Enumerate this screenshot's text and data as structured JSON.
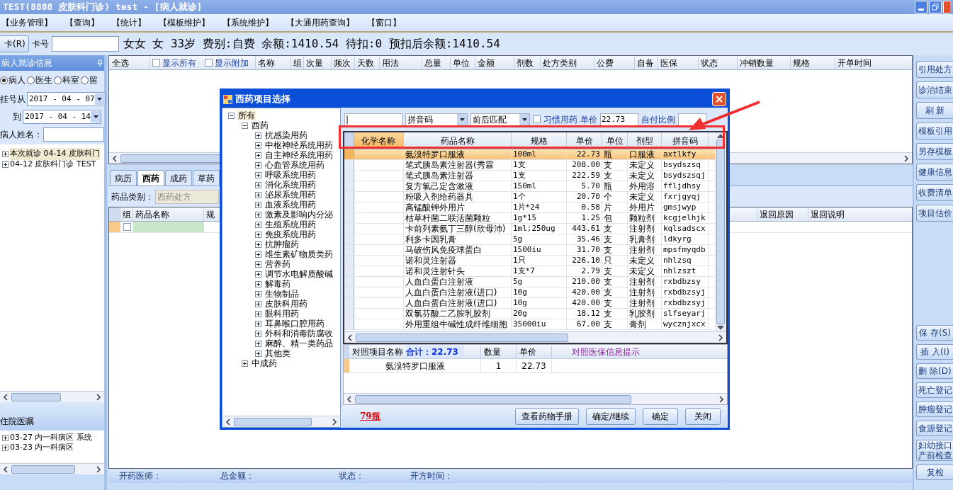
{
  "window": {
    "title": "TEST(8888 皮肤科门诊) test - [病人就诊]"
  },
  "menu": [
    "【业务管理】",
    "【查询】",
    "【统计】",
    "【模板维护】",
    "【系统维护】",
    "【大通用药查询】",
    "【窗口】"
  ],
  "patient_bar": {
    "read_card_button": "卡(R)",
    "card_label": "卡号",
    "info": "女女 女 33岁 费别:自费 余额:1410.54 待扣:0 预扣后余额:1410.54"
  },
  "left_panel": {
    "title": "病人就诊信息",
    "radios": [
      {
        "label": "病人",
        "selected": true
      },
      {
        "label": "医生",
        "selected": false
      },
      {
        "label": "科室",
        "selected": false
      },
      {
        "label": "留",
        "selected": false
      }
    ],
    "date_from_label": "挂号从",
    "date_from": "2017 - 04 - 07",
    "date_to_label": "到",
    "date_to": "2017 - 04 - 14",
    "name_label": "病人姓名：",
    "visits": [
      {
        "label": "本次就诊 04-14 皮肤科门",
        "selected": true
      },
      {
        "label": "04-12 皮肤科门诊 TEST",
        "selected": false
      }
    ],
    "inpatient_title": "住院医嘱",
    "inpatient_orders": [
      "03-27 内一科病区 系统",
      "03-23 内一科病区"
    ]
  },
  "order_grid": {
    "select_all": "全选",
    "toggles": [
      {
        "label": "显示所有",
        "checked": false
      },
      {
        "label": "显示附加",
        "checked": false
      }
    ],
    "columns": [
      "名称",
      "组",
      "次量",
      "频次",
      "天数",
      "用法",
      "总量",
      "单位",
      "金额",
      "剂数",
      "处方类别",
      "公费",
      "自备",
      "医保",
      "状态",
      "冲销数量",
      "规格",
      "开单时间"
    ]
  },
  "tabs": [
    {
      "label": "病历",
      "selected": false
    },
    {
      "label": "西药",
      "selected": true
    },
    {
      "label": "成药",
      "selected": false
    },
    {
      "label": "草药",
      "selected": false
    }
  ],
  "category": {
    "label": "药品类别：",
    "value": "西药处方"
  },
  "detail_grid": {
    "columns": [
      "组",
      "药品名称",
      "规"
    ],
    "columns_right": [
      "退回原因",
      "退回说明"
    ],
    "row_checked": false
  },
  "footer": [
    "开药医师：",
    "总金额：",
    "状态：",
    "开方时间："
  ],
  "side_buttons_top": [
    "引用处方",
    "诊治结束",
    "刷 新",
    "模板引用",
    "另存模板",
    "健康信息",
    "收费清单",
    "项目估价"
  ],
  "side_buttons_bottom": [
    "保 存(S)",
    "插 入(I)",
    "删 除(D)",
    "死亡登记",
    "肿瘤登记",
    "食源登记",
    "妇幼接口产前检查",
    "复检"
  ],
  "dialog": {
    "title": "西药项目选择",
    "tree": [
      {
        "label": "所有",
        "expanded": true,
        "children": [
          {
            "label": "西药",
            "expanded": true,
            "children": [
              {
                "label": "抗感染用药",
                "expanded": false
              },
              {
                "label": "中枢神经系统用药",
                "expanded": false
              },
              {
                "label": "自主神经系统用药",
                "expanded": false
              },
              {
                "label": "心血管系统用药",
                "expanded": false
              },
              {
                "label": "呼吸系统用药",
                "expanded": false
              },
              {
                "label": "消化系统用药",
                "expanded": false
              },
              {
                "label": "泌尿系统用药",
                "expanded": false
              },
              {
                "label": "血液系统用药",
                "expanded": false
              },
              {
                "label": "激素及影响内分泌",
                "expanded": false
              },
              {
                "label": "生殖系统用药",
                "expanded": false
              },
              {
                "label": "免疫系统用药",
                "expanded": false
              },
              {
                "label": "抗肿瘤药",
                "expanded": false
              },
              {
                "label": "维生素矿物质类药",
                "expanded": false
              },
              {
                "label": "营养药",
                "expanded": false
              },
              {
                "label": "调节水电解质酸碱",
                "expanded": false
              },
              {
                "label": "解毒药",
                "expanded": false
              },
              {
                "label": "生物制品",
                "expanded": false
              },
              {
                "label": "皮肤科用药",
                "expanded": false
              },
              {
                "label": "眼科用药",
                "expanded": false
              },
              {
                "label": "耳鼻喉口腔用药",
                "expanded": false
              },
              {
                "label": "外科和消毒防腐收",
                "expanded": false
              },
              {
                "label": "麻醉、精一类药品",
                "expanded": false
              },
              {
                "label": "其他类",
                "expanded": false
              }
            ]
          },
          {
            "label": "中成药",
            "expanded": false
          }
        ]
      }
    ],
    "search_value": "|",
    "search_mode": "拼音码",
    "match_mode": "前后匹配",
    "habit": {
      "label": "习惯用药",
      "checked": false
    },
    "price_label": "单价",
    "price": "22.73",
    "ratio_label": "自付比例",
    "columns": [
      "化学名称",
      "药品名称",
      "规格",
      "单价",
      "单位",
      "剂型",
      "拼音码"
    ],
    "rows": [
      {
        "cells": [
          "",
          "氨溴特罗口服液",
          "100ml",
          "22.73",
          "瓶",
          "口服液",
          "axtlkfy"
        ],
        "selected": true
      },
      {
        "cells": [
          "",
          "笔式胰岛素注射器(秀霖",
          "1支",
          "208.00",
          "支",
          "未定义",
          "bsydszsq"
        ],
        "selected": false
      },
      {
        "cells": [
          "",
          "笔式胰岛素注射器",
          "1支",
          "222.59",
          "支",
          "未定义",
          "bsydszsqj"
        ],
        "selected": false
      },
      {
        "cells": [
          "",
          "复方氯己定含漱液",
          "150ml",
          "5.70",
          "瓶",
          "外用溶",
          "ffljdhsy"
        ],
        "selected": false
      },
      {
        "cells": [
          "",
          "粉吸入剂给药器具",
          "1个",
          "20.70",
          "个",
          "未定义",
          "fxrjgyqj"
        ],
        "selected": false
      },
      {
        "cells": [
          "",
          "高锰酸钾外用片",
          "1片*24",
          "0.58",
          "片",
          "外用片",
          "gmsjwyp"
        ],
        "selected": false
      },
      {
        "cells": [
          "",
          "枯草杆菌二联活菌颗粒",
          "1g*15",
          "1.25",
          "包",
          "颗粒剂",
          "kcgjelhjk"
        ],
        "selected": false
      },
      {
        "cells": [
          "",
          "卡前列素氨丁三醇(欣母沛)",
          "1ml;250ug",
          "443.61",
          "支",
          "注射剂",
          "kqlsadscx"
        ],
        "selected": false
      },
      {
        "cells": [
          "",
          "利多卡因乳膏",
          "5g",
          "35.46",
          "支",
          "乳膏剂",
          "ldkyrg"
        ],
        "selected": false
      },
      {
        "cells": [
          "",
          "马破伤风免疫球蛋白",
          "1500iu",
          "31.70",
          "支",
          "注射剂",
          "mpsfmyqdb"
        ],
        "selected": false
      },
      {
        "cells": [
          "",
          "诺和灵注射器",
          "1只",
          "226.10",
          "只",
          "未定义",
          "nhlzsq"
        ],
        "selected": false
      },
      {
        "cells": [
          "",
          "诺和灵注射针头",
          "1支*7",
          "2.79",
          "支",
          "未定义",
          "nhlzszt"
        ],
        "selected": false
      },
      {
        "cells": [
          "",
          "人血白蛋白注射液",
          "5g",
          "210.00",
          "支",
          "注射剂",
          "rxbdbzsy"
        ],
        "selected": false
      },
      {
        "cells": [
          "",
          "人血白蛋白注射液(进口)",
          "10g",
          "420.00",
          "支",
          "注射剂",
          "rxbdbzsyj"
        ],
        "selected": false
      },
      {
        "cells": [
          "",
          "人血白蛋白注射液(进口)",
          "10g",
          "420.00",
          "支",
          "注射剂",
          "rxbdbzsyj"
        ],
        "selected": false
      },
      {
        "cells": [
          "",
          "双氯芬酸二乙胺乳胶剂",
          "20g",
          "18.12",
          "支",
          "乳胶剂",
          "slfseyarj"
        ],
        "selected": false
      },
      {
        "cells": [
          "",
          "外用重组牛碱性成纤维细胞",
          "35000iu",
          "67.00",
          "支",
          "膏剂",
          "wycznjxcx"
        ],
        "selected": false
      }
    ],
    "compare": {
      "columns": [
        "对照项目名称",
        "数量",
        "单价",
        "对照医保信息提示"
      ],
      "total": "合计：22.73",
      "rows": [
        [
          "氨溴特罗口服液",
          "1",
          "22.73",
          ""
        ]
      ]
    },
    "count_link": "79瓶",
    "buttons": [
      "查看药物手册",
      "确定/继续",
      "确定",
      "关闭"
    ]
  }
}
